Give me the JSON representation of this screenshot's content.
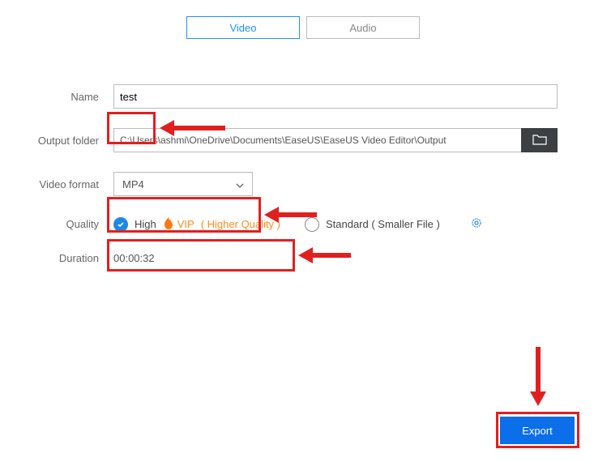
{
  "tabs": {
    "video": "Video",
    "audio": "Audio"
  },
  "labels": {
    "name": "Name",
    "output_folder": "Output folder",
    "video_format": "Video format",
    "quality": "Quality",
    "duration": "Duration"
  },
  "fields": {
    "name_value": "test",
    "output_path": "C:\\Users\\ashmi\\OneDrive\\Documents\\EaseUS\\EaseUS Video Editor\\Output",
    "video_format_selected": "MP4",
    "duration_value": "00:00:32"
  },
  "quality": {
    "high_label": "High",
    "vip_label": "VIP",
    "higher_quality": "( Higher Quality )",
    "standard_label": "Standard ( Smaller File )"
  },
  "export_button": "Export"
}
